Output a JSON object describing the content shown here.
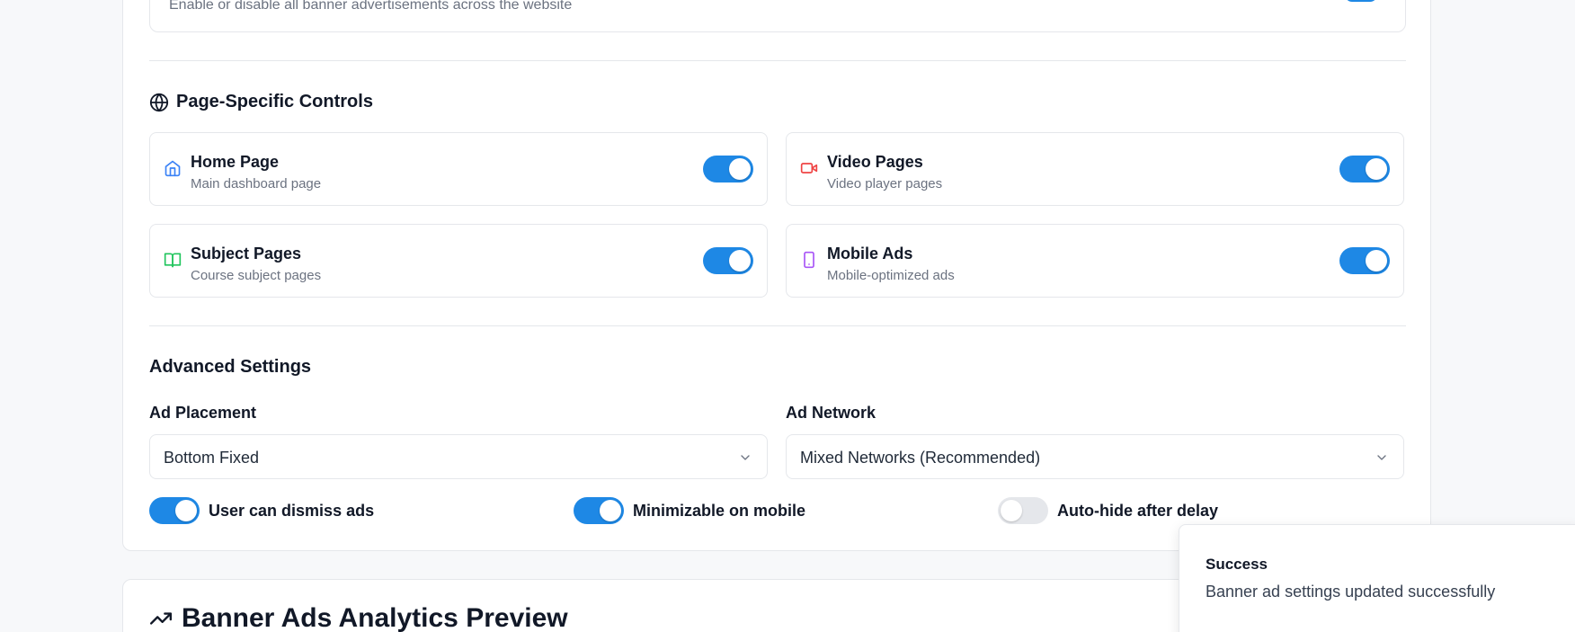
{
  "global_banner": {
    "description": "Enable or disable all banner advertisements across the website",
    "enabled": true
  },
  "page_controls": {
    "title": "Page-Specific Controls",
    "icon": "globe-icon",
    "items": [
      {
        "title": "Home Page",
        "description": "Main dashboard page",
        "icon": "home-icon",
        "icon_color": "#3b82f6",
        "enabled": true
      },
      {
        "title": "Video Pages",
        "description": "Video player pages",
        "icon": "video-icon",
        "icon_color": "#ef4444",
        "enabled": true
      },
      {
        "title": "Subject Pages",
        "description": "Course subject pages",
        "icon": "book-open-icon",
        "icon_color": "#22c55e",
        "enabled": true
      },
      {
        "title": "Mobile Ads",
        "description": "Mobile-optimized ads",
        "icon": "smartphone-icon",
        "icon_color": "#a855f7",
        "enabled": true
      }
    ]
  },
  "advanced": {
    "title": "Advanced Settings",
    "placement": {
      "label": "Ad Placement",
      "value": "Bottom Fixed"
    },
    "network": {
      "label": "Ad Network",
      "value": "Mixed Networks (Recommended)"
    },
    "options": [
      {
        "label": "User can dismiss ads",
        "enabled": true
      },
      {
        "label": "Minimizable on mobile",
        "enabled": true
      },
      {
        "label": "Auto-hide after delay",
        "enabled": false
      }
    ]
  },
  "analytics": {
    "title": "Banner Ads Analytics Preview",
    "icon": "trending-up-icon"
  },
  "toast": {
    "title": "Success",
    "message": "Banner ad settings updated successfully"
  },
  "colors": {
    "accent": "#1e88e5",
    "toggle_off": "#e5e7eb",
    "border": "#e5e7eb",
    "muted_text": "#6b7280"
  }
}
